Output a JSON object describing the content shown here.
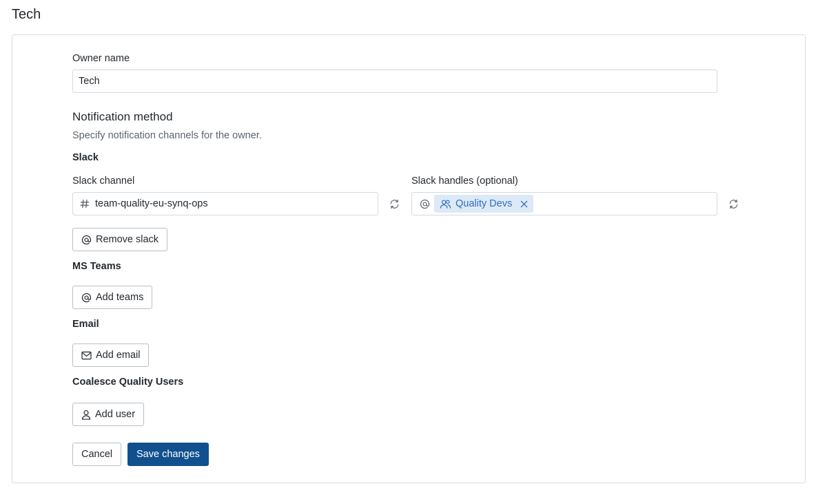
{
  "page": {
    "title": "Tech"
  },
  "form": {
    "owner_name_label": "Owner name",
    "owner_name_value": "Tech",
    "notification_heading": "Notification method",
    "notification_description": "Specify notification channels for the owner.",
    "slack": {
      "heading": "Slack",
      "channel_label": "Slack channel",
      "channel_value": "team-quality-eu-synq-ops",
      "handles_label": "Slack handles (optional)",
      "handles": [
        {
          "label": "Quality Devs",
          "icon": "users-icon"
        }
      ],
      "remove_label": "Remove slack"
    },
    "teams": {
      "heading": "MS Teams",
      "add_label": "Add teams"
    },
    "email": {
      "heading": "Email",
      "add_label": "Add email"
    },
    "users": {
      "heading": "Coalesce Quality Users",
      "add_label": "Add user"
    },
    "actions": {
      "cancel_label": "Cancel",
      "save_label": "Save changes"
    }
  },
  "colors": {
    "primary": "#11508e",
    "chip_bg": "#dde9f7",
    "chip_text": "#2e6fbd",
    "border": "#d4d9df"
  }
}
